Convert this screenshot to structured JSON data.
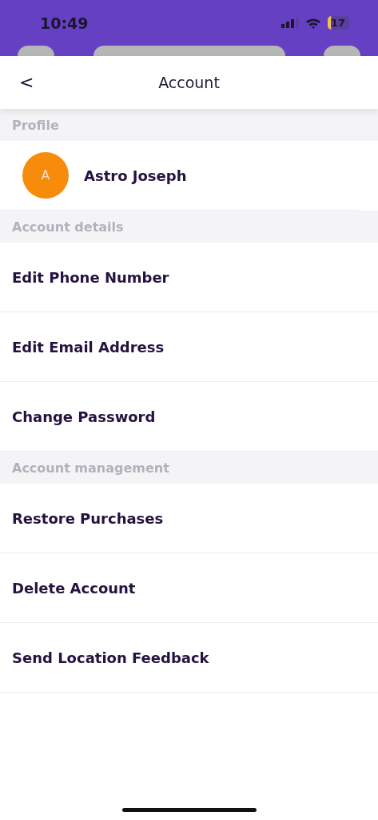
{
  "status_bar": {
    "time": "10:49",
    "battery": "17"
  },
  "header": {
    "title": "Account",
    "back": "<"
  },
  "sections": [
    {
      "title": "Profile",
      "kind": "profile",
      "profile": {
        "initial": "A",
        "name": "Astro Joseph"
      }
    },
    {
      "title": "Account details",
      "kind": "list",
      "items": [
        "Edit Phone Number",
        "Edit Email Address",
        "Change Password"
      ]
    },
    {
      "title": "Account management",
      "kind": "list",
      "items": [
        "Restore Purchases",
        "Delete Account",
        "Send Location Feedback"
      ]
    }
  ]
}
